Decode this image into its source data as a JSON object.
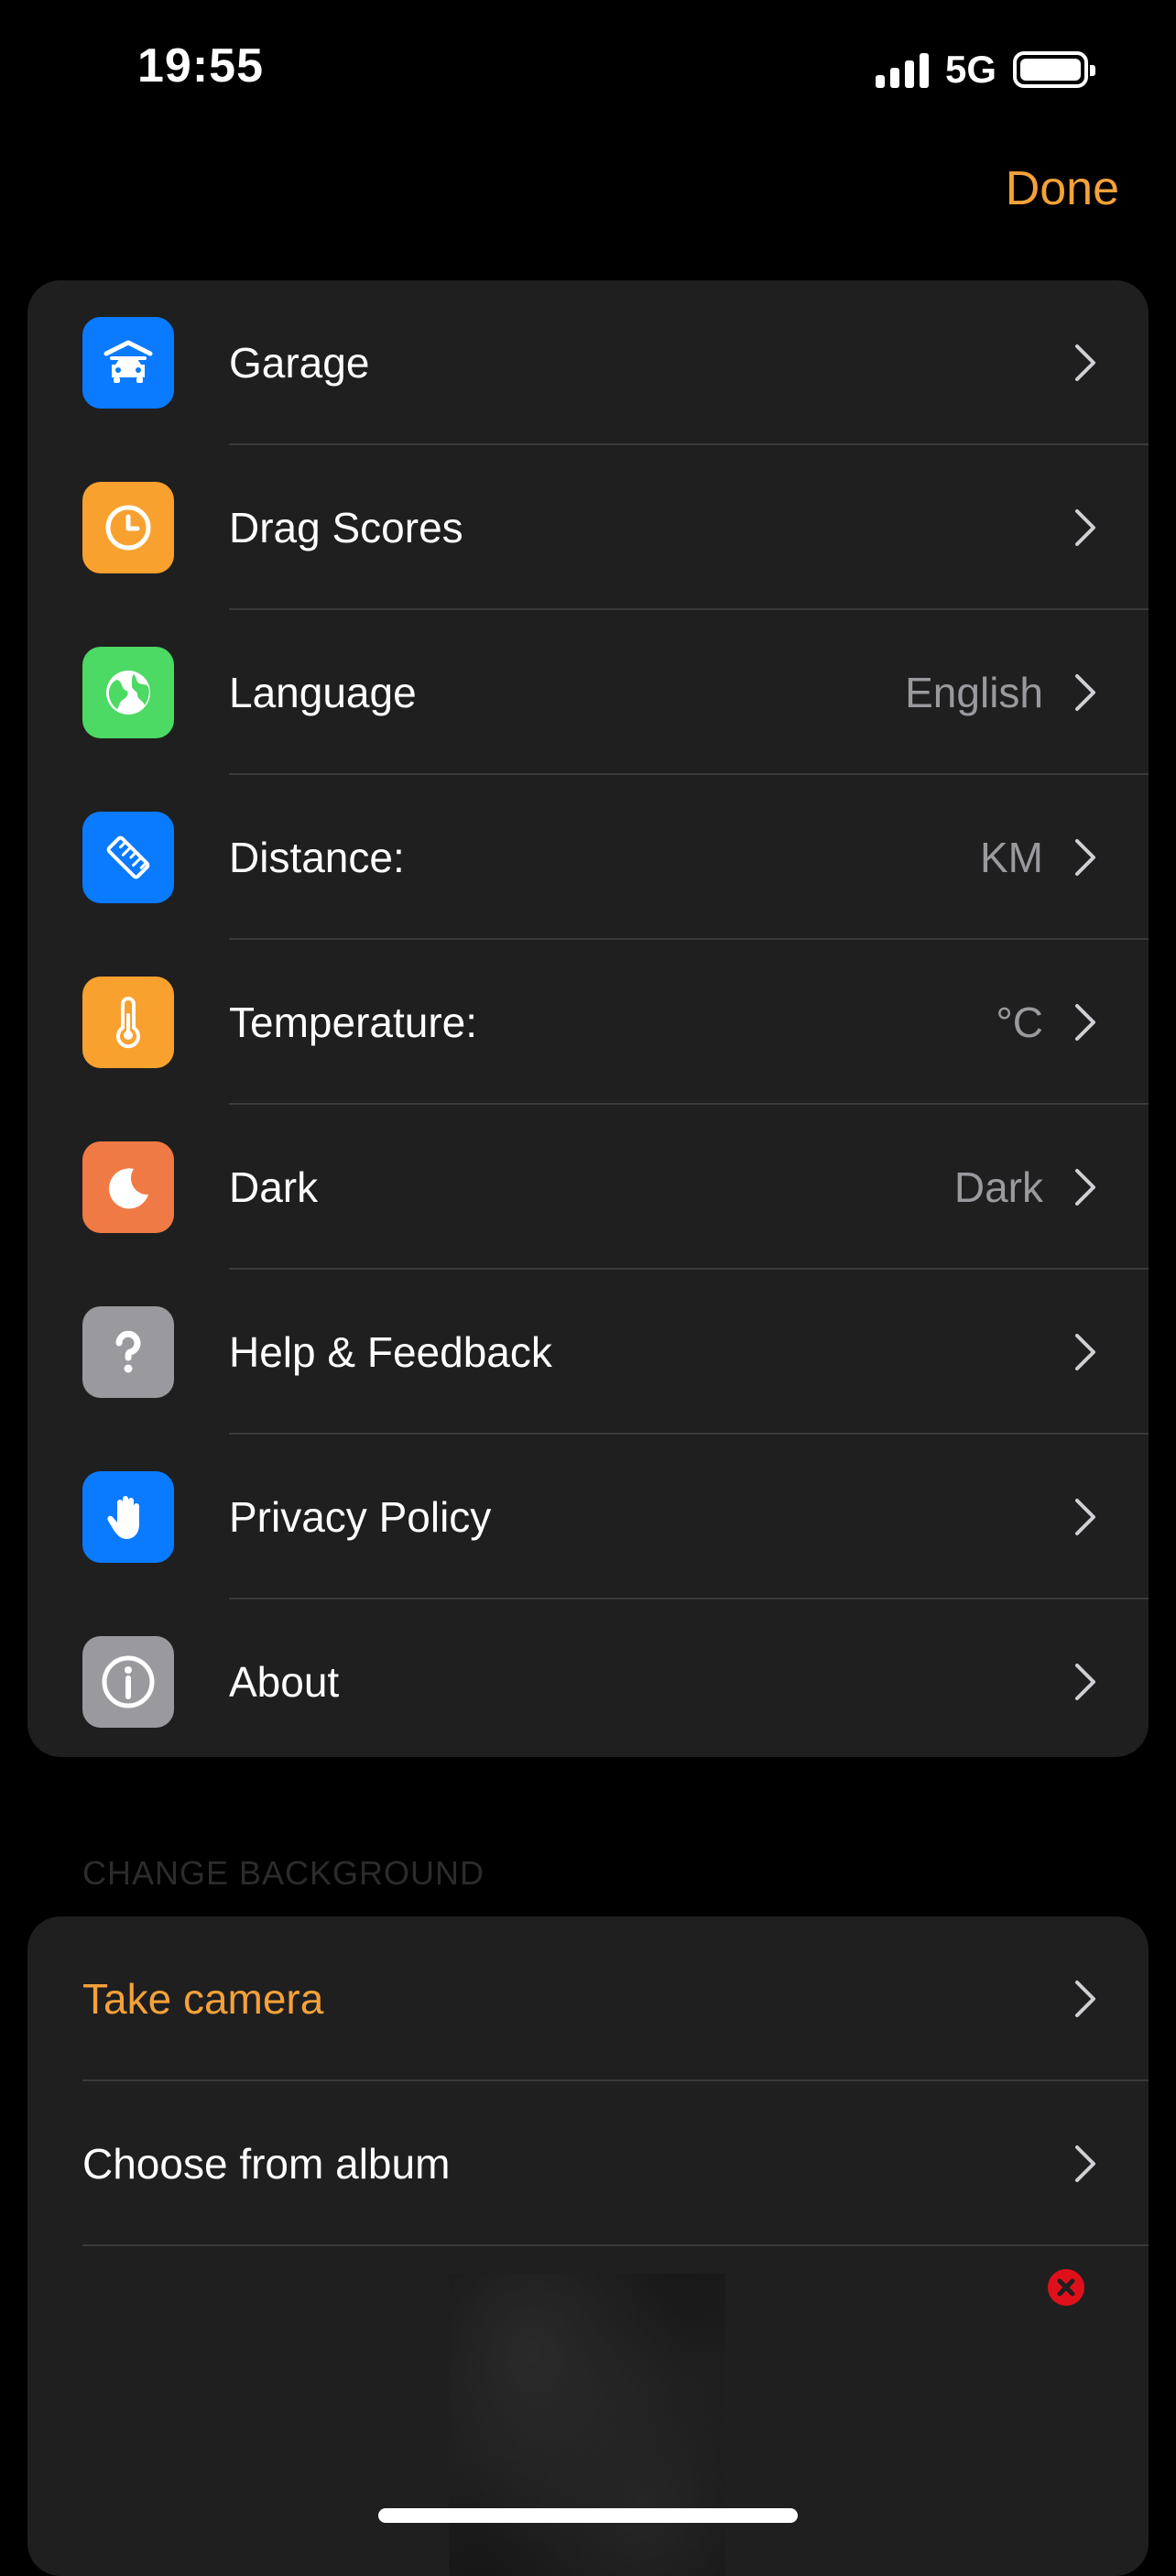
{
  "status_bar": {
    "time": "19:55",
    "network": "5G",
    "signal_bars": 4,
    "battery_level": 1.0
  },
  "header": {
    "done_label": "Done",
    "accent_color": "#f5a13a"
  },
  "settings": {
    "items": [
      {
        "label": "Garage",
        "value": "",
        "icon": "car-garage-icon",
        "icon_bg": "#0a7afe"
      },
      {
        "label": "Drag Scores",
        "value": "",
        "icon": "clock-icon",
        "icon_bg": "#f8a12f"
      },
      {
        "label": "Language",
        "value": "English",
        "icon": "globe-icon",
        "icon_bg": "#4cd964"
      },
      {
        "label": "Distance:",
        "value": "KM",
        "icon": "ruler-icon",
        "icon_bg": "#0a7afe"
      },
      {
        "label": "Temperature:",
        "value": "°C",
        "icon": "thermometer-icon",
        "icon_bg": "#f8a12f"
      },
      {
        "label": "Dark",
        "value": "Dark",
        "icon": "moon-icon",
        "icon_bg": "#f07a45"
      },
      {
        "label": "Help & Feedback",
        "value": "",
        "icon": "question-icon",
        "icon_bg": "#9a9a9e"
      },
      {
        "label": "Privacy Policy",
        "value": "",
        "icon": "hand-icon",
        "icon_bg": "#0a7afe"
      },
      {
        "label": "About",
        "value": "",
        "icon": "info-icon",
        "icon_bg": "#9a9a9e"
      }
    ]
  },
  "background_section": {
    "header": "CHANGE BACKGROUND",
    "take_camera_label": "Take camera",
    "choose_album_label": "Choose from album",
    "remove_color": "#e0101a"
  }
}
